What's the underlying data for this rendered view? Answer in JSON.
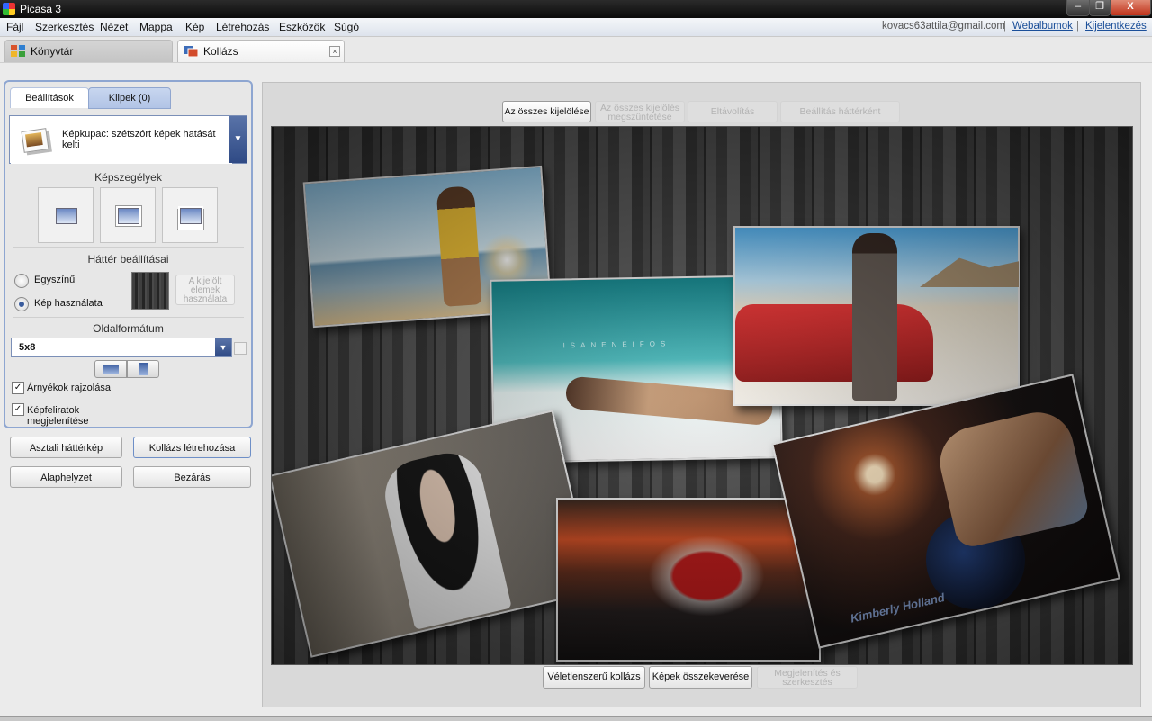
{
  "window": {
    "title": "Picasa 3",
    "minimize_icon": "minimize-icon",
    "maximize_icon": "maximize-icon",
    "close_icon": "close-icon",
    "minimize_glyph": "–",
    "maximize_glyph": "❐",
    "close_glyph": "X"
  },
  "menu": {
    "items": [
      "Fájl",
      "Szerkesztés",
      "Nézet",
      "Mappa",
      "Kép",
      "Létrehozás",
      "Eszközök",
      "Súgó"
    ],
    "account": "kovacs63attila@gmail.com",
    "separator": "|",
    "web_albums": "Webalbumok",
    "logout": "Kijelentkezés"
  },
  "tabs": {
    "library": "Könyvtár",
    "collage": "Kollázs",
    "close_glyph": "×"
  },
  "panel": {
    "tab_settings": "Beállítások",
    "tab_clips": "Klipek (0)",
    "preset": {
      "text": "Képkupac: szétszórt képek hatását kelti",
      "dropdown_glyph": "▼"
    },
    "borders_title": "Képszegélyek",
    "background_title": "Háttér beállításai",
    "radio_solid": "Egyszínű",
    "radio_image": "Kép használata",
    "use_selected": "A kijelölt elemek használata",
    "format_title": "Oldalformátum",
    "format_value": "5x8",
    "format_dropdown_glyph": "▼",
    "checkbox_shadows": "Árnyékok rajzolása",
    "checkbox_captions": "Képfeliratok megjelenítése",
    "check_glyph": "✓",
    "checkbox_shadows_checked": true,
    "checkbox_captions_checked": true,
    "selected_background": "Kép használata"
  },
  "actions": {
    "desktop_bg": "Asztali háttérkép",
    "create_collage": "Kollázs létrehozása",
    "reset": "Alaphelyzet",
    "close": "Bezárás"
  },
  "toolbar": {
    "select_all": "Az összes kijelölése",
    "deselect_all": "Az összes kijelölés megszüntetése",
    "remove": "Eltávolítás",
    "set_background": "Beállítás háttérként"
  },
  "bottom": {
    "random_collage": "Véletlenszerű kollázs",
    "shuffle": "Képek összekeverése",
    "view_edit": "Megjelenítés és szerkesztés"
  },
  "collage": {
    "teal_text": "ISANENEIFOS",
    "signature": "Kimberly Holland"
  }
}
